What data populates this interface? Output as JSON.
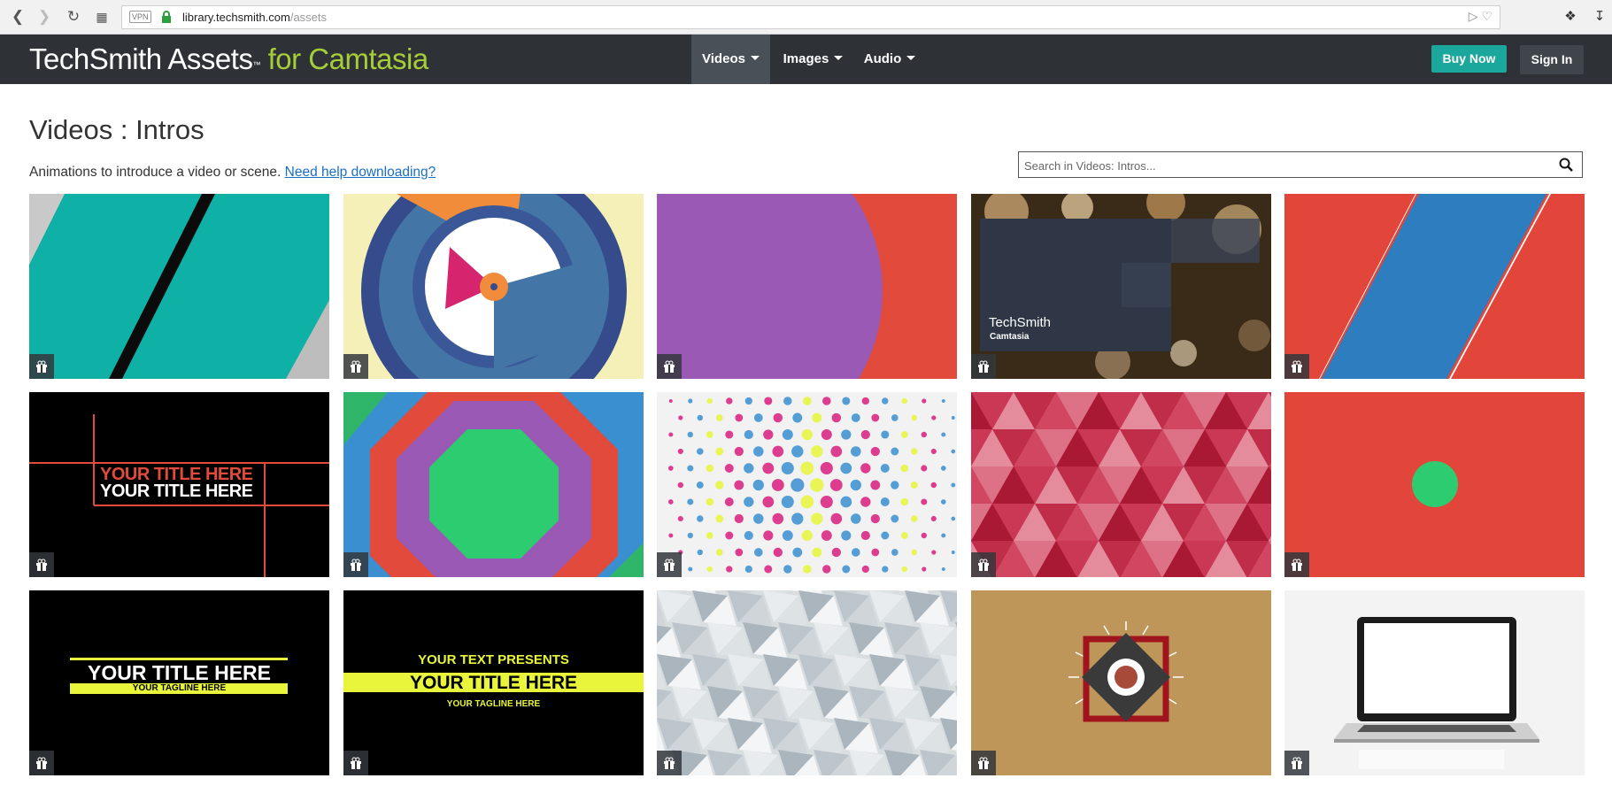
{
  "browser": {
    "vpn_label": "VPN",
    "url_host": "library.techsmith.com",
    "url_path": "/assets"
  },
  "header": {
    "brand_main": "TechSmith Assets",
    "brand_tm": "™",
    "brand_accent": "for Camtasia",
    "menus": [
      {
        "label": "Videos",
        "active": true
      },
      {
        "label": "Images",
        "active": false
      },
      {
        "label": "Audio",
        "active": false
      }
    ],
    "buy_label": "Buy Now",
    "signin_label": "Sign In"
  },
  "page": {
    "title": "Videos : Intros",
    "description": "Animations to introduce a video or scene.",
    "help_link": "Need help downloading?",
    "search_placeholder": "Search in Videos: Intros..."
  },
  "tiles": [
    {
      "theme": "teal-diagonal"
    },
    {
      "theme": "blue-circles"
    },
    {
      "theme": "purple-red-circle"
    },
    {
      "theme": "bokeh-techsmith",
      "text1": "TechSmith",
      "text2": "Camtasia"
    },
    {
      "theme": "red-blue-stripe"
    },
    {
      "theme": "black-red-lines",
      "text1": "YOUR TITLE HERE",
      "text2": "YOUR TITLE HERE"
    },
    {
      "theme": "octagon"
    },
    {
      "theme": "dots"
    },
    {
      "theme": "red-triangles"
    },
    {
      "theme": "red-green-dot"
    },
    {
      "theme": "black-title",
      "text1": "YOUR TITLE HERE",
      "text2": "YOUR TAGLINE HERE"
    },
    {
      "theme": "black-yellow-title",
      "text1": "YOUR TEXT PRESENTS",
      "text2": "YOUR TITLE HERE",
      "text3": "YOUR TAGLINE HERE"
    },
    {
      "theme": "grey-poly"
    },
    {
      "theme": "tan-target"
    },
    {
      "theme": "laptop"
    }
  ]
}
